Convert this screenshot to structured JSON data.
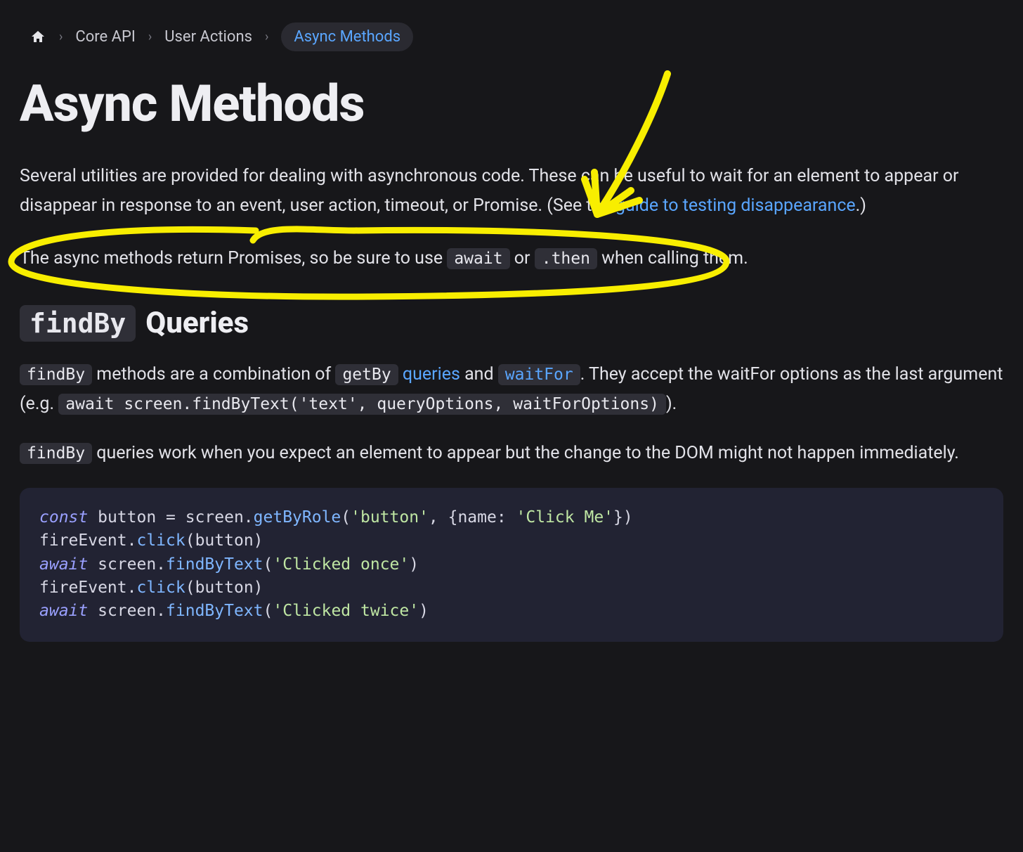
{
  "breadcrumb": {
    "items": [
      "Core API",
      "User Actions"
    ],
    "current": "Async Methods"
  },
  "title": "Async Methods",
  "intro": {
    "part1": "Several utilities are provided for dealing with asynchronous code. These can be useful to wait for an element to appear or disappear in response to an event, user action, timeout, or Promise. (See the ",
    "link": "guide to testing disappearance",
    "part2": ".)"
  },
  "callout": {
    "pre": "The async methods return Promises, so be sure to use ",
    "code1": "await",
    "mid": " or ",
    "code2": ".then",
    "post": " when calling them."
  },
  "section": {
    "code": "findBy",
    "word": "Queries"
  },
  "para1": {
    "c1": "findBy",
    "t1": " methods are a combination of ",
    "c2": "getBy",
    "l1": "queries",
    "t2": " and ",
    "c3": "waitFor",
    "t3": ". They accept the waitFor options as the last argument (e.g. ",
    "c4": "await screen.findByText('text', queryOptions, waitForOptions)",
    "t4": ")."
  },
  "para2": {
    "c1": "findBy",
    "t1": " queries work when you expect an element to appear but the change to the DOM might not happen immediately."
  },
  "code": {
    "line1": {
      "kw": "const",
      "t1": " button = screen.",
      "fn": "getByRole",
      "t2": "(",
      "s1": "'button'",
      "t3": ", {name: ",
      "s2": "'Click Me'",
      "t4": "})"
    },
    "line2": {
      "t1": "fireEvent.",
      "fn": "click",
      "t2": "(button)"
    },
    "line3": {
      "kw": "await",
      "t1": " screen.",
      "fn": "findByText",
      "t2": "(",
      "s1": "'Clicked once'",
      "t3": ")"
    },
    "line4": {
      "t1": "fireEvent.",
      "fn": "click",
      "t2": "(button)"
    },
    "line5": {
      "kw": "await",
      "t1": " screen.",
      "fn": "findByText",
      "t2": "(",
      "s1": "'Clicked twice'",
      "t3": ")"
    }
  },
  "annotation": {
    "type": "hand-drawn-highlight",
    "color": "#f8ee00",
    "shapes": [
      "arrow-pointing-down-left",
      "oval-circle-around-callout"
    ]
  }
}
